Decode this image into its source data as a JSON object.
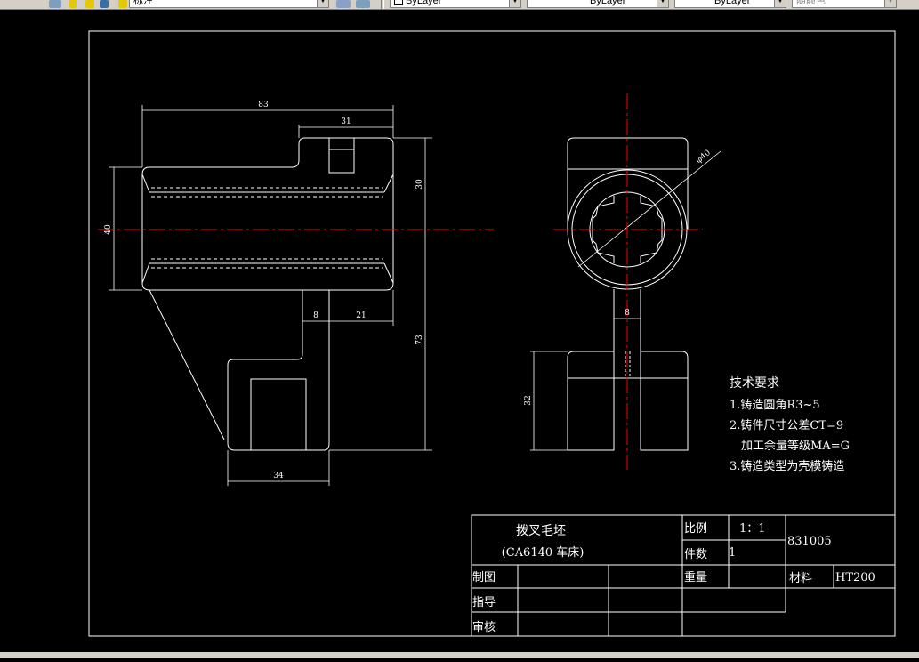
{
  "toolbar": {
    "layer_name": "标注",
    "color": "ByLayer",
    "linetype": "ByLayer",
    "lineweight": "ByLayer",
    "plot_style": "随颜色"
  },
  "dimensions": {
    "total_length": "83",
    "top_width": "31",
    "bore_height": "30",
    "left_height": "40",
    "web_width": "8",
    "right_offset": "21",
    "total_height": "73",
    "foot_width": "34",
    "diameter": "φ40",
    "side_web": "8",
    "foot_height": "32"
  },
  "tech_requirements": {
    "title": "技术要求",
    "items": [
      "1.铸造圆角R3~5",
      "2.铸件尺寸公差CT=9",
      "加工余量等级MA=G",
      "3.铸造类型为壳模铸造"
    ]
  },
  "title_block": {
    "part_name": "拨叉毛坯",
    "machine": "(CA6140 车床)",
    "scale_label": "比例",
    "scale_value": "1：1",
    "quantity_label": "件数",
    "quantity_value": "1",
    "drawing_number": "831005",
    "weight_label": "重量",
    "material_label": "材料",
    "material_value": "HT200",
    "drafted_label": "制图",
    "guide_label": "指导",
    "review_label": "审核"
  },
  "colors": {
    "background": "#000000",
    "line": "#ffffff",
    "centerline": "#ff0000",
    "toolbar": "#d4d0c8"
  }
}
